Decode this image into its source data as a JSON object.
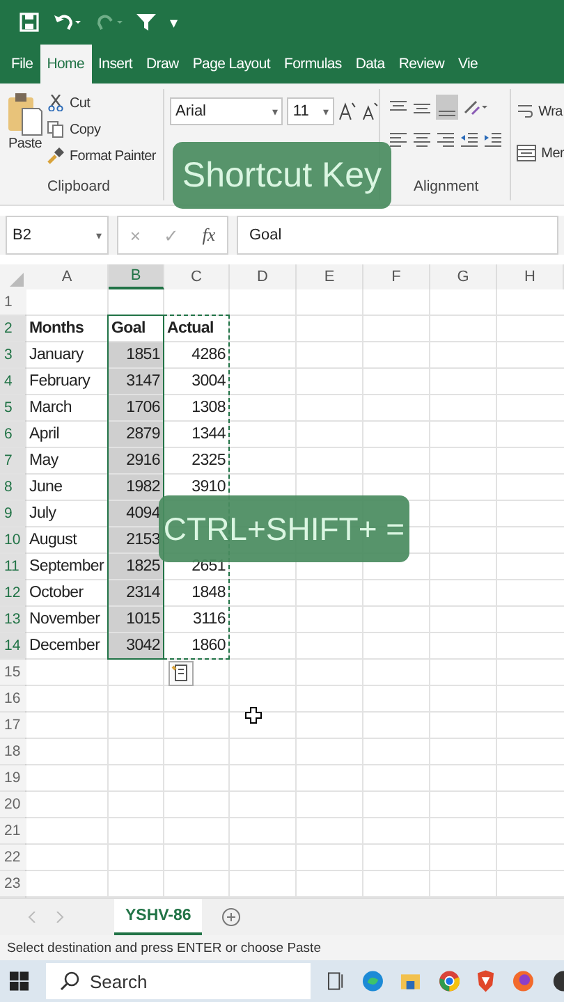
{
  "quick_access": {
    "more": "▾"
  },
  "tabs": [
    {
      "label": "File",
      "selected": false
    },
    {
      "label": "Home",
      "selected": true
    },
    {
      "label": "Insert",
      "selected": false
    },
    {
      "label": "Draw",
      "selected": false
    },
    {
      "label": "Page Layout",
      "selected": false
    },
    {
      "label": "Formulas",
      "selected": false
    },
    {
      "label": "Data",
      "selected": false
    },
    {
      "label": "Review",
      "selected": false
    },
    {
      "label": "Vie",
      "selected": false
    }
  ],
  "ribbon": {
    "clipboard": {
      "paste": "Paste",
      "cut": "Cut",
      "copy": "Copy",
      "format_painter": "Format Painter",
      "label": "Clipboard"
    },
    "font": {
      "font_name": "Arial",
      "font_size": "11"
    },
    "alignment": {
      "wrap": "Wra",
      "merge": "Mer",
      "label": "Alignment"
    }
  },
  "formula_bar": {
    "name_box": "B2",
    "cancel": "×",
    "enter": "✓",
    "function_label": "fx",
    "formula": "Goal"
  },
  "grid": {
    "columns": [
      {
        "label": "A",
        "selected": false,
        "copied": false
      },
      {
        "label": "B",
        "selected": true,
        "copied": false
      },
      {
        "label": "C",
        "selected": false,
        "copied": true
      },
      {
        "label": "D",
        "selected": false,
        "copied": false
      },
      {
        "label": "E",
        "selected": false,
        "copied": false
      },
      {
        "label": "F",
        "selected": false,
        "copied": false
      },
      {
        "label": "G",
        "selected": false,
        "copied": false
      },
      {
        "label": "H",
        "selected": false,
        "copied": false
      }
    ],
    "rows": [
      {
        "number": "1",
        "selected": false
      },
      {
        "number": "2",
        "kind": "header",
        "selected": true,
        "cells": {
          "A": "Months",
          "B": "Goal",
          "C": "Actual"
        }
      },
      {
        "number": "3",
        "selected": true,
        "cells": {
          "A": "January",
          "B": "1851",
          "C": "4286"
        }
      },
      {
        "number": "4",
        "selected": true,
        "cells": {
          "A": "February",
          "B": "3147",
          "C": "3004"
        }
      },
      {
        "number": "5",
        "selected": true,
        "cells": {
          "A": "March",
          "B": "1706",
          "C": "1308"
        }
      },
      {
        "number": "6",
        "selected": true,
        "cells": {
          "A": "April",
          "B": "2879",
          "C": "1344"
        }
      },
      {
        "number": "7",
        "selected": true,
        "cells": {
          "A": "May",
          "B": "2916",
          "C": "2325"
        }
      },
      {
        "number": "8",
        "selected": true,
        "cells": {
          "A": "June",
          "B": "1982",
          "C": "3910"
        }
      },
      {
        "number": "9",
        "selected": true,
        "cells": {
          "A": "July",
          "B": "4094"
        }
      },
      {
        "number": "10",
        "selected": true,
        "cells": {
          "A": "August",
          "B": "2153"
        }
      },
      {
        "number": "11",
        "selected": true,
        "cells": {
          "A": "September",
          "B": "1825",
          "C": "2651"
        }
      },
      {
        "number": "12",
        "selected": true,
        "cells": {
          "A": "October",
          "B": "2314",
          "C": "1848"
        }
      },
      {
        "number": "13",
        "selected": true,
        "cells": {
          "A": "November",
          "B": "1015",
          "C": "3116"
        }
      },
      {
        "number": "14",
        "selected": true,
        "cells": {
          "A": "December",
          "B": "3042",
          "C": "1860"
        }
      },
      {
        "number": "15",
        "selected": false
      },
      {
        "number": "16",
        "selected": false
      },
      {
        "number": "17",
        "selected": false
      },
      {
        "number": "18",
        "selected": false
      },
      {
        "number": "19",
        "selected": false
      },
      {
        "number": "20",
        "selected": false
      },
      {
        "number": "21",
        "selected": false
      },
      {
        "number": "22",
        "selected": false
      },
      {
        "number": "23",
        "selected": false
      }
    ]
  },
  "sheet_tabs": [
    {
      "label": "YSHV-86",
      "selected": true
    }
  ],
  "status_bar": "Select destination and press ENTER or choose Paste",
  "taskbar": {
    "search": {
      "placeholder": "Search"
    }
  },
  "captions": [
    {
      "text": "Shortcut Key"
    },
    {
      "text": "CTRL+SHIFT+ ="
    }
  ]
}
